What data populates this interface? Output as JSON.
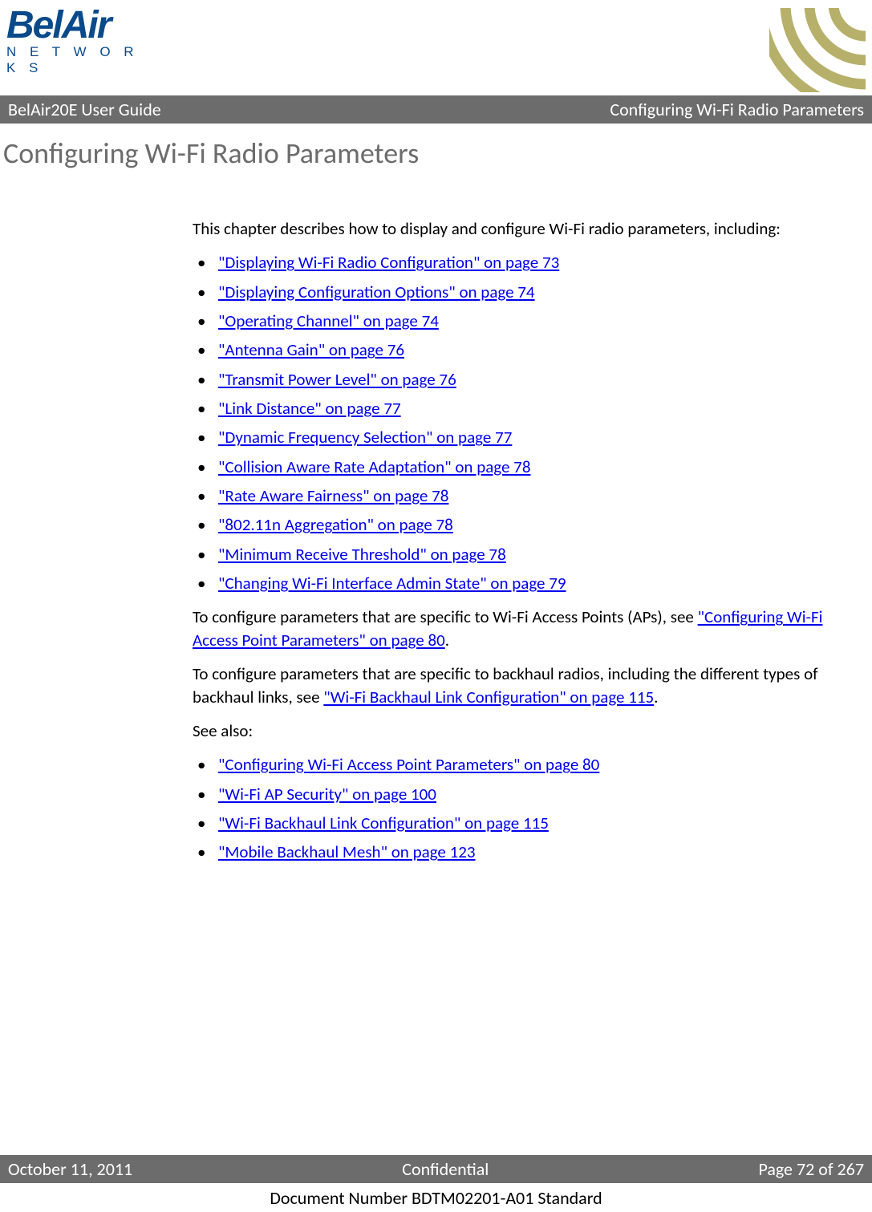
{
  "logo": {
    "name": "BelAir",
    "sub": "N E T W O R K S"
  },
  "titlebar": {
    "left": "BelAir20E User Guide",
    "right": "Configuring Wi-Fi Radio Parameters"
  },
  "chapter_title": "Configuring Wi-Fi Radio Parameters",
  "intro": "This chapter describes how to display and configure Wi-Fi radio parameters, including:",
  "links_main": [
    "\"Displaying Wi-Fi Radio Configuration\" on page 73",
    "\"Displaying Configuration Options\" on page 74",
    "\"Operating Channel\" on page 74",
    "\"Antenna Gain\" on page 76",
    "\"Transmit Power Level\" on page 76",
    "\"Link Distance\" on page 77",
    "\"Dynamic Frequency Selection\" on page 77",
    "\"Collision Aware Rate Adaptation\" on page 78",
    "\"Rate Aware Fairness\" on page 78",
    "\"802.11n Aggregation\" on page 78",
    "\"Minimum Receive Threshold\" on page 78",
    "\"Changing Wi-Fi Interface Admin State\" on page 79"
  ],
  "para_ap": {
    "pre": "To configure parameters that are specific to Wi-Fi Access Points (APs), see ",
    "link": "\"Configuring Wi-Fi Access Point Parameters\" on page 80",
    "post": "."
  },
  "para_backhaul": {
    "pre": "To configure parameters that are specific to backhaul radios, including the different types of backhaul links, see ",
    "link": "\"Wi-Fi Backhaul Link Configuration\" on page 115",
    "post": "."
  },
  "see_also_label": "See also:",
  "links_seealso": [
    "\"Configuring Wi-Fi Access Point Parameters\" on page 80",
    "\"Wi-Fi AP Security\" on page 100",
    "\"Wi-Fi Backhaul Link Configuration\" on page 115",
    "\"Mobile Backhaul Mesh\" on page 123"
  ],
  "footer": {
    "left": "October 11, 2011",
    "center": "Confidential",
    "right": "Page 72 of 267"
  },
  "docnum": "Document Number BDTM02201-A01 Standard"
}
